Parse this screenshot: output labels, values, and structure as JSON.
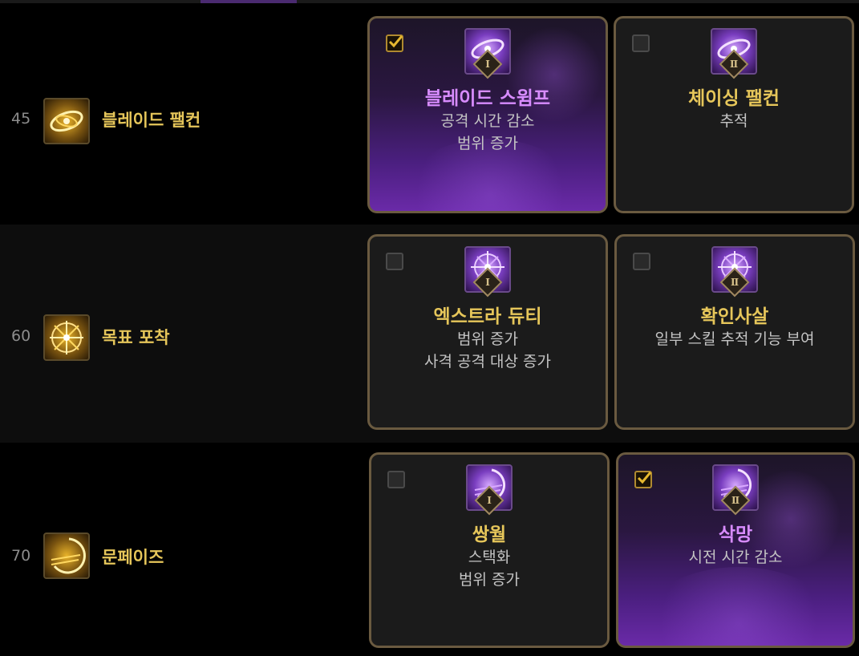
{
  "rows": [
    {
      "level": "45",
      "skill": "블레이드 팰컨",
      "options": [
        {
          "numeral": "Ⅰ",
          "title": "블레이드 스윔프",
          "desc": [
            "공격 시간 감소",
            "범위 증가"
          ],
          "selected": true
        },
        {
          "numeral": "Ⅱ",
          "title": "체이싱 팰컨",
          "desc": [
            "추적"
          ],
          "selected": false
        }
      ]
    },
    {
      "level": "60",
      "skill": "목표 포착",
      "options": [
        {
          "numeral": "Ⅰ",
          "title": "엑스트라 듀티",
          "desc": [
            "범위 증가",
            "사격 공격 대상 증가"
          ],
          "selected": false
        },
        {
          "numeral": "Ⅱ",
          "title": "확인사살",
          "desc": [
            "일부 스킬 추적 기능 부여"
          ],
          "selected": false
        }
      ]
    },
    {
      "level": "70",
      "skill": "문페이즈",
      "options": [
        {
          "numeral": "Ⅰ",
          "title": "쌍월",
          "desc": [
            "스택화",
            "범위 증가"
          ],
          "selected": false
        },
        {
          "numeral": "Ⅱ",
          "title": "삭망",
          "desc": [
            "시전 시간 감소"
          ],
          "selected": true
        }
      ]
    }
  ],
  "colors": {
    "accent_gold": "#e6c65a",
    "selected_title": "#d88cff",
    "selected_bg": "#6a2aa8",
    "card_border": "#6a5a40"
  },
  "icons": {
    "skill": [
      "blade-falcon-icon",
      "target-lock-icon",
      "moon-phase-icon"
    ],
    "option": [
      [
        "blade-swirl-icon",
        "blade-swirl-icon"
      ],
      [
        "crosshair-icon",
        "crosshair-icon"
      ],
      [
        "crescent-slash-icon",
        "crescent-slash-icon"
      ]
    ]
  }
}
